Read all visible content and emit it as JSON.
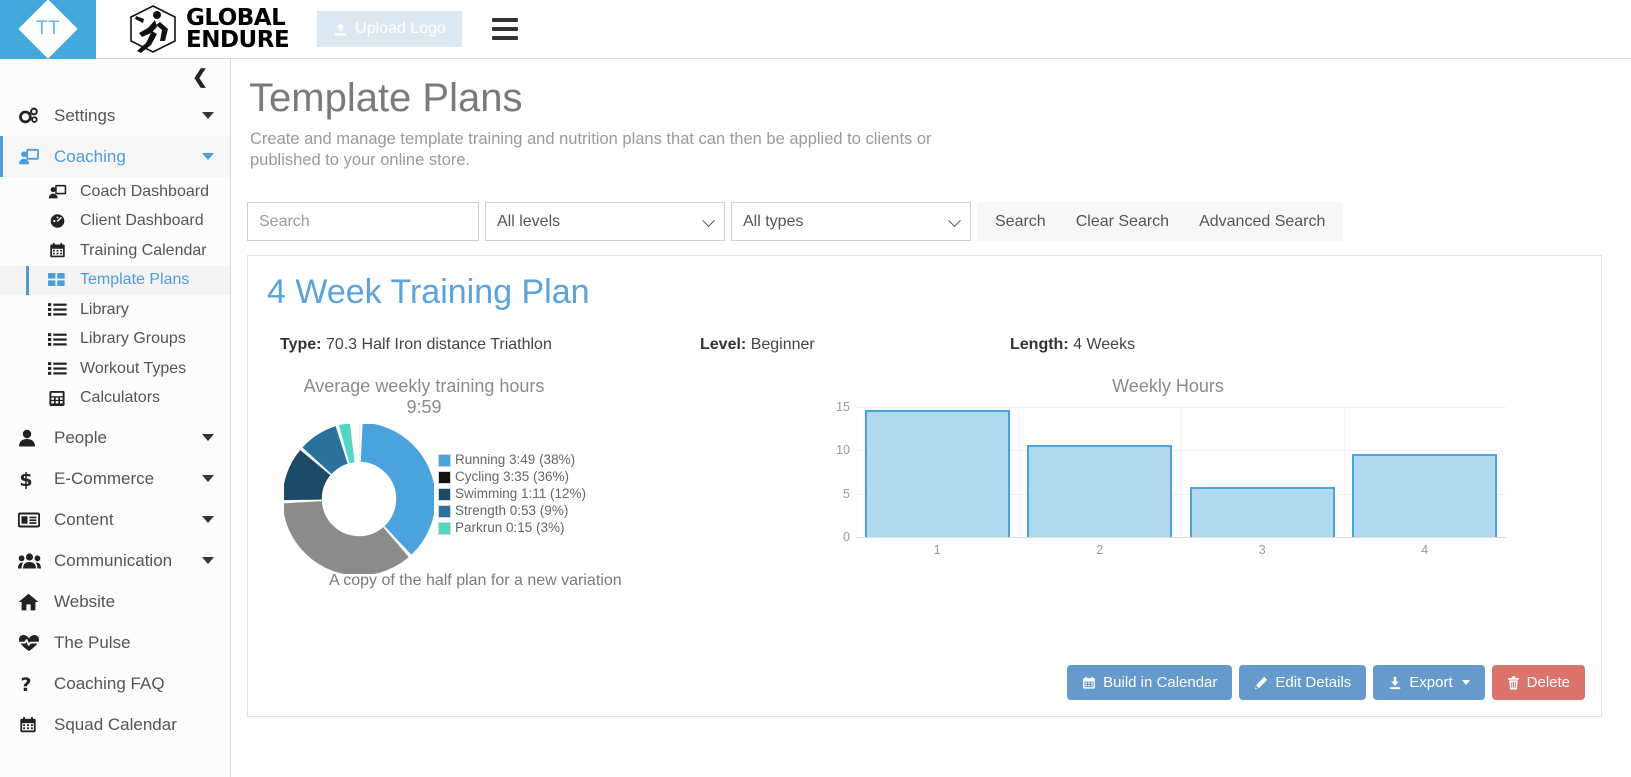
{
  "header": {
    "logo_initials": "TT",
    "brand_line1": "GLOBAL",
    "brand_line2": "ENDURE",
    "upload_label": "Upload Logo",
    "upload_icon": "upload-icon",
    "menu_icon": "hamburger-icon"
  },
  "sidebar": {
    "collapse_icon": "chevron-left-icon",
    "items": [
      {
        "label": "Settings",
        "icon": "gears-icon",
        "expandable": true,
        "active": false
      },
      {
        "label": "Coaching",
        "icon": "coach-screen-icon",
        "expandable": true,
        "active": true
      },
      {
        "label": "People",
        "icon": "person-icon",
        "expandable": true,
        "active": false
      },
      {
        "label": "E-Commerce",
        "icon": "dollar-icon",
        "expandable": true,
        "active": false
      },
      {
        "label": "Content",
        "icon": "newspaper-icon",
        "expandable": true,
        "active": false
      },
      {
        "label": "Communication",
        "icon": "users-icon",
        "expandable": true,
        "active": false
      },
      {
        "label": "Website",
        "icon": "home-icon",
        "expandable": false,
        "active": false
      },
      {
        "label": "The Pulse",
        "icon": "heartbeat-icon",
        "expandable": false,
        "active": false
      },
      {
        "label": "Coaching FAQ",
        "icon": "question-icon",
        "expandable": false,
        "active": false
      },
      {
        "label": "Squad Calendar",
        "icon": "calendar-icon",
        "expandable": false,
        "active": false
      }
    ],
    "coaching_children": [
      {
        "label": "Coach Dashboard",
        "icon": "coach-screen-icon",
        "current": false
      },
      {
        "label": "Client Dashboard",
        "icon": "gauge-icon",
        "current": false
      },
      {
        "label": "Training Calendar",
        "icon": "calendar-icon",
        "current": false
      },
      {
        "label": "Template Plans",
        "icon": "grid-squares-icon",
        "current": true
      },
      {
        "label": "Library",
        "icon": "list-icon",
        "current": false
      },
      {
        "label": "Library Groups",
        "icon": "list-icon",
        "current": false
      },
      {
        "label": "Workout Types",
        "icon": "list-icon",
        "current": false
      },
      {
        "label": "Calculators",
        "icon": "calculator-icon",
        "current": false
      }
    ]
  },
  "page": {
    "title": "Template Plans",
    "description": "Create and manage template training and nutrition plans that can then be applied to clients or published to your online store."
  },
  "toolbar": {
    "search_placeholder": "Search",
    "search_value": "",
    "level_select": "All levels",
    "type_select": "All types",
    "search_label": "Search",
    "clear_label": "Clear Search",
    "advanced_label": "Advanced Search"
  },
  "plan": {
    "title": "4 Week Training Plan",
    "type_label": "Type:",
    "type_value": "70.3 Half Iron distance Triathlon",
    "level_label": "Level:",
    "level_value": "Beginner",
    "length_label": "Length:",
    "length_value": "4 Weeks",
    "note": "A copy of the half plan for a new variation",
    "buttons": [
      {
        "label": "Build in Calendar",
        "icon": "calendar-icon",
        "style": "primary"
      },
      {
        "label": "Edit Details",
        "icon": "pencil-icon",
        "style": "primary"
      },
      {
        "label": "Export",
        "icon": "download-icon",
        "style": "primary",
        "has_caret": true
      },
      {
        "label": "Delete",
        "icon": "trash-icon",
        "style": "danger"
      }
    ]
  },
  "chart_data": [
    {
      "type": "pie",
      "title": "Average weekly training hours 9:59",
      "labels": [
        "Running",
        "Cycling",
        "Swimming",
        "Strength",
        "Parkrun"
      ],
      "legend_entries": [
        "Running 3:49 (38%)",
        "Cycling 3:35 (36%)",
        "Swimming 1:11 (12%)",
        "Strength 0:53 (9%)",
        "Parkrun 0:15 (3%)"
      ],
      "values": [
        38,
        36,
        12,
        9,
        3
      ],
      "durations": [
        "3:49",
        "3:35",
        "1:11",
        "0:53",
        "0:15"
      ],
      "colors": [
        "#4aa3dc",
        "#8b8b8b",
        "#1d4a66",
        "#2a719c",
        "#52d6c4"
      ],
      "legend_position": "right",
      "donut": true
    },
    {
      "type": "bar",
      "title": "Weekly Hours",
      "categories": [
        "1",
        "2",
        "3",
        "4"
      ],
      "values": [
        14.7,
        10.6,
        5.8,
        9.6
      ],
      "xlabel": "",
      "ylabel": "",
      "ylim": [
        0,
        15
      ],
      "yticks": [
        0,
        5,
        10,
        15
      ],
      "grid": true,
      "bar_fill": "#b0d9f0",
      "bar_stroke": "#4ba3db"
    }
  ]
}
